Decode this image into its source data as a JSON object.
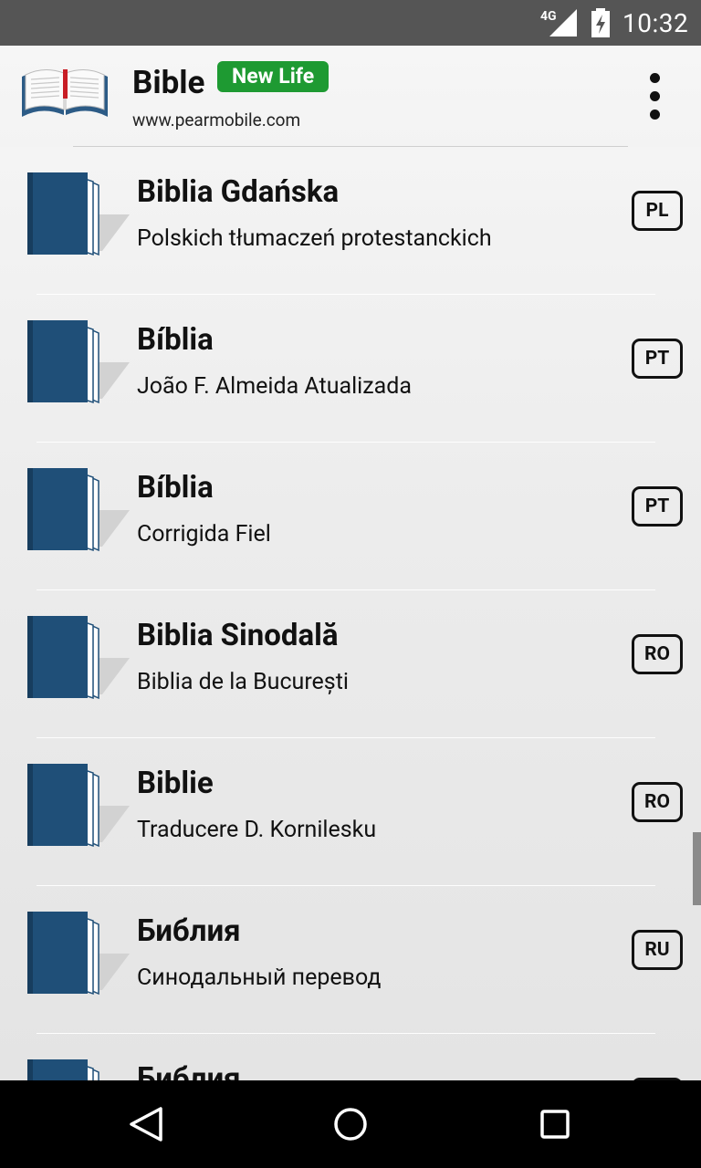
{
  "status_bar": {
    "network": "4G",
    "time": "10:32"
  },
  "app_bar": {
    "title": "Bible",
    "badge": "New Life",
    "url": "www.pearmobile.com",
    "logo_icon": "open-bible-icon",
    "menu_icon": "more-vert-icon"
  },
  "colors": {
    "badge_green": "#1e9a32",
    "book_blue": "#1f4f78",
    "status_bar": "#555555"
  },
  "list": {
    "items": [
      {
        "title": "Biblia Gdańska",
        "subtitle": "Polskich tłumaczeń protestanckich",
        "lang": "PL"
      },
      {
        "title": "Bíblia",
        "subtitle": "João F. Almeida Atualizada",
        "lang": "PT"
      },
      {
        "title": "Bíblia",
        "subtitle": "Corrigida Fiel",
        "lang": "PT"
      },
      {
        "title": "Biblia Sinodală",
        "subtitle": "Biblia de la București",
        "lang": "RO"
      },
      {
        "title": "Biblie",
        "subtitle": "Traducere D. Kornilesku",
        "lang": "RO"
      },
      {
        "title": "Библия",
        "subtitle": "Синодальный перевод",
        "lang": "RU"
      },
      {
        "title": "Библия",
        "subtitle": "",
        "lang": ""
      }
    ]
  },
  "nav_bar": {
    "back_icon": "back-icon",
    "home_icon": "home-icon",
    "recents_icon": "recents-icon"
  }
}
